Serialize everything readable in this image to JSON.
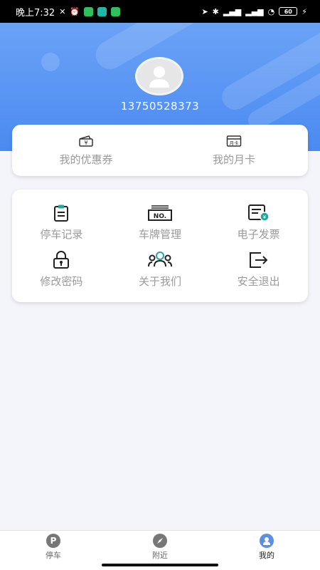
{
  "status_bar": {
    "time": "晚上7:32",
    "battery": "60",
    "colors": {
      "background": "#000000"
    }
  },
  "profile": {
    "phone": "13750528373"
  },
  "quick_cards": [
    {
      "label": "我的优惠券",
      "icon": "coupon-icon"
    },
    {
      "label": "我的月卡",
      "icon": "monthly-card-icon"
    }
  ],
  "menu": [
    {
      "label": "停车记录",
      "icon": "parking-record-icon"
    },
    {
      "label": "车牌管理",
      "icon": "license-plate-icon"
    },
    {
      "label": "电子发票",
      "icon": "invoice-icon"
    },
    {
      "label": "修改密码",
      "icon": "lock-icon"
    },
    {
      "label": "关于我们",
      "icon": "about-us-icon"
    },
    {
      "label": "安全退出",
      "icon": "logout-icon"
    }
  ],
  "tabbar": {
    "items": [
      {
        "label": "停车",
        "icon": "parking-icon",
        "active": false
      },
      {
        "label": "附近",
        "icon": "compass-icon",
        "active": false
      },
      {
        "label": "我的",
        "icon": "profile-icon",
        "active": true
      }
    ]
  },
  "colors": {
    "primary": "#4b8af1",
    "accent_teal": "#21a89a"
  }
}
